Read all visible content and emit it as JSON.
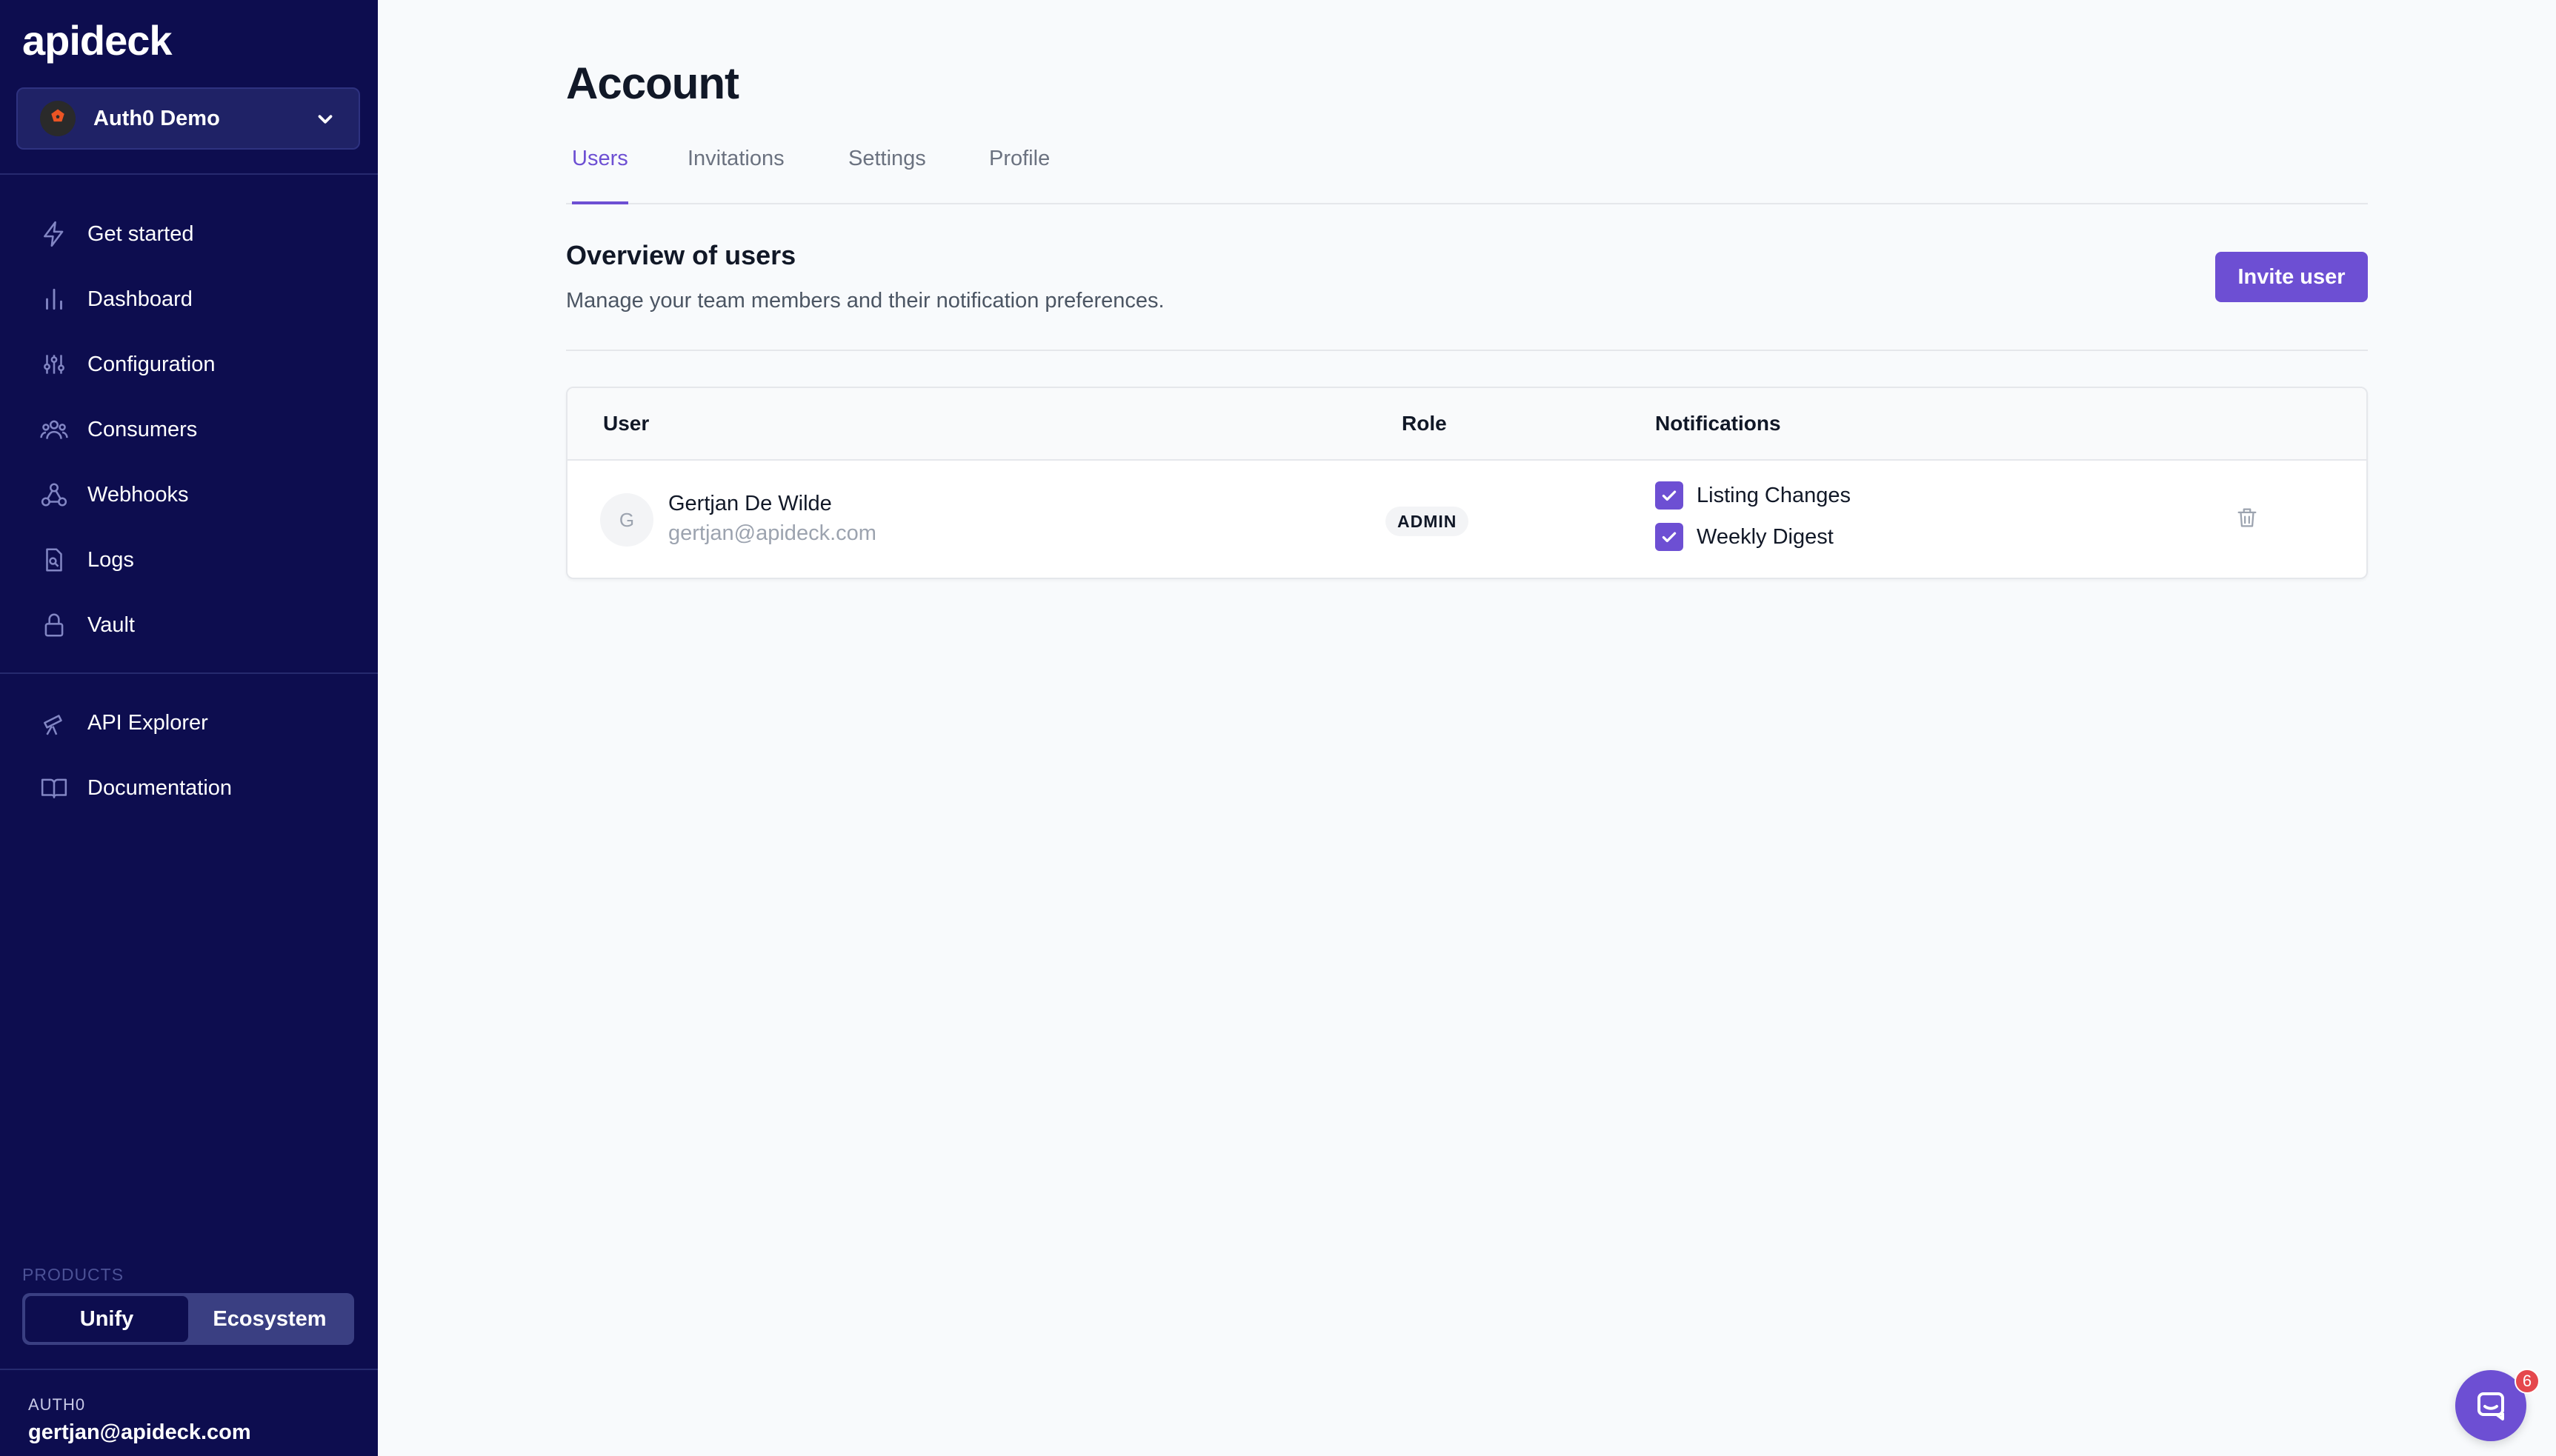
{
  "app": {
    "logo": "apideck"
  },
  "workspace": {
    "name": "Auth0 Demo"
  },
  "sidebar": {
    "items": [
      {
        "label": "Get started",
        "icon": "lightning-icon"
      },
      {
        "label": "Dashboard",
        "icon": "bar-chart-icon"
      },
      {
        "label": "Configuration",
        "icon": "sliders-icon"
      },
      {
        "label": "Consumers",
        "icon": "users-icon"
      },
      {
        "label": "Webhooks",
        "icon": "webhook-icon"
      },
      {
        "label": "Logs",
        "icon": "document-search-icon"
      },
      {
        "label": "Vault",
        "icon": "lock-icon"
      }
    ],
    "secondary": [
      {
        "label": "API Explorer",
        "icon": "telescope-icon"
      },
      {
        "label": "Documentation",
        "icon": "book-icon"
      }
    ],
    "products_label": "PRODUCTS",
    "products": [
      "Unify",
      "Ecosystem"
    ],
    "active_product": "Unify",
    "org_label": "AUTH0",
    "org_email": "gertjan@apideck.com"
  },
  "page": {
    "title": "Account",
    "tabs": [
      "Users",
      "Invitations",
      "Settings",
      "Profile"
    ],
    "active_tab": "Users"
  },
  "section": {
    "title": "Overview of users",
    "description": "Manage your team members and their notification preferences.",
    "invite_label": "Invite user"
  },
  "table": {
    "headers": {
      "user": "User",
      "role": "Role",
      "notifications": "Notifications"
    },
    "rows": [
      {
        "initial": "G",
        "name": "Gertjan De Wilde",
        "email": "gertjan@apideck.com",
        "role": "ADMIN",
        "notifications": [
          {
            "label": "Listing Changes",
            "checked": true
          },
          {
            "label": "Weekly Digest",
            "checked": true
          }
        ]
      }
    ]
  },
  "chat": {
    "badge_count": "6"
  },
  "colors": {
    "sidebar_bg": "#0d0d4f",
    "accent": "#6d4fd3",
    "badge_red": "#e5484d"
  }
}
